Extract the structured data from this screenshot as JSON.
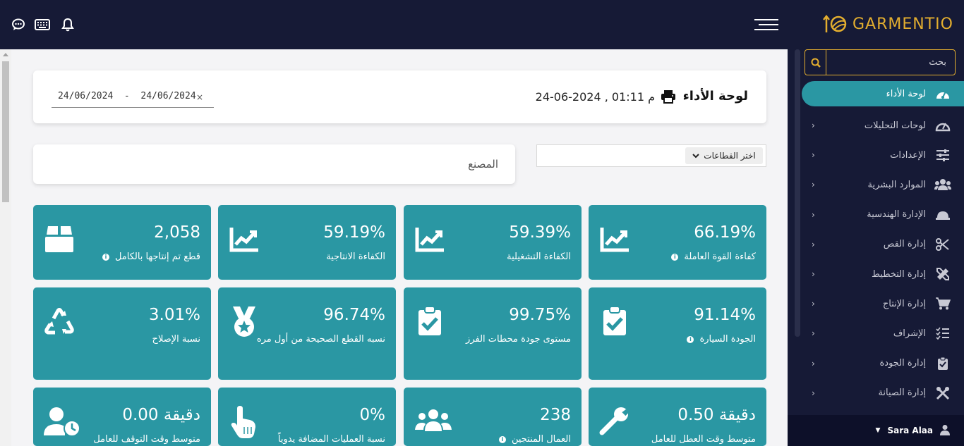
{
  "topbar": {
    "brand_name": "GARMENTIO",
    "icons": [
      "chat-icon",
      "keyboard-icon",
      "bell-icon",
      "menu-icon"
    ]
  },
  "header": {
    "title": "لوحة الأداء",
    "datetime": "24-06-2024 , 01:11 م",
    "date_range": "24/06/2024  -  24/06/2024",
    "clear": "×"
  },
  "filters": {
    "factory_label": "المصنع",
    "sector_label": "اختر القطاعات"
  },
  "search": {
    "placeholder": "بحث"
  },
  "sidebar": {
    "items": [
      {
        "label": "لوحة الأداء",
        "icon": "dashboard-icon",
        "active": true
      },
      {
        "label": "لوحات التحليلات",
        "icon": "gauge-icon"
      },
      {
        "label": "الإعدادات",
        "icon": "sliders-icon"
      },
      {
        "label": "الموارد البشرية",
        "icon": "users-icon"
      },
      {
        "label": "الإدارة الهندسية",
        "icon": "hard-hat-icon"
      },
      {
        "label": "إدارة القص",
        "icon": "scissors-icon"
      },
      {
        "label": "إدارة التخطيط",
        "icon": "ruler-pencil-icon"
      },
      {
        "label": "إدارة الإنتاج",
        "icon": "cart-icon"
      },
      {
        "label": "الإشراف",
        "icon": "tasks-icon"
      },
      {
        "label": "إدارة الجودة",
        "icon": "clipboard-check-icon"
      },
      {
        "label": "إدارة الصيانة",
        "icon": "tools-icon"
      }
    ],
    "user": "Sara Alaa"
  },
  "tiles": [
    {
      "value": "66.19%",
      "label": "كفاءة القوة العاملة",
      "info": true,
      "icon": "chart-line-icon"
    },
    {
      "value": "59.39%",
      "label": "الكفاءة التشغيلية",
      "info": false,
      "icon": "chart-line-icon"
    },
    {
      "value": "59.19%",
      "label": "الكفاءة الانتاجية",
      "info": false,
      "icon": "chart-line-icon"
    },
    {
      "value": "2,058",
      "label": "قطع تم إنتاجها بالكامل",
      "info": true,
      "icon": "box-icon"
    },
    {
      "value": "91.14%",
      "label": "الجودة السيارة",
      "info": true,
      "icon": "clipboard-check-icon"
    },
    {
      "value": "99.75%",
      "label": "مستوى جودة محطات الفرز",
      "info": false,
      "icon": "clipboard-check-icon"
    },
    {
      "value": "96.74%",
      "label": "نسبه القطع الصحيحة من أول مره",
      "info": false,
      "icon": "medal-icon"
    },
    {
      "value": "3.01%",
      "label": "نسبة الإصلاح",
      "info": false,
      "icon": "recycle-icon"
    },
    {
      "value": "0.50 دقيقة",
      "label": "متوسط وقت العطل للعامل",
      "info": false,
      "icon": "wrench-icon"
    },
    {
      "value": "238",
      "label": "العمال المنتجين",
      "info": true,
      "icon": "users-icon"
    },
    {
      "value": "0%",
      "label": "نسبة العمليات المضافة يدوياً",
      "info": false,
      "icon": "hand-pointer-icon"
    },
    {
      "value": "0.00 دقيقة",
      "label": "متوسط وقت التوقف للعامل",
      "info": false,
      "icon": "user-clock-icon"
    }
  ],
  "colors": {
    "topbar": "#161a36",
    "accent": "#2a97a3",
    "brand": "#e3ae2f"
  }
}
